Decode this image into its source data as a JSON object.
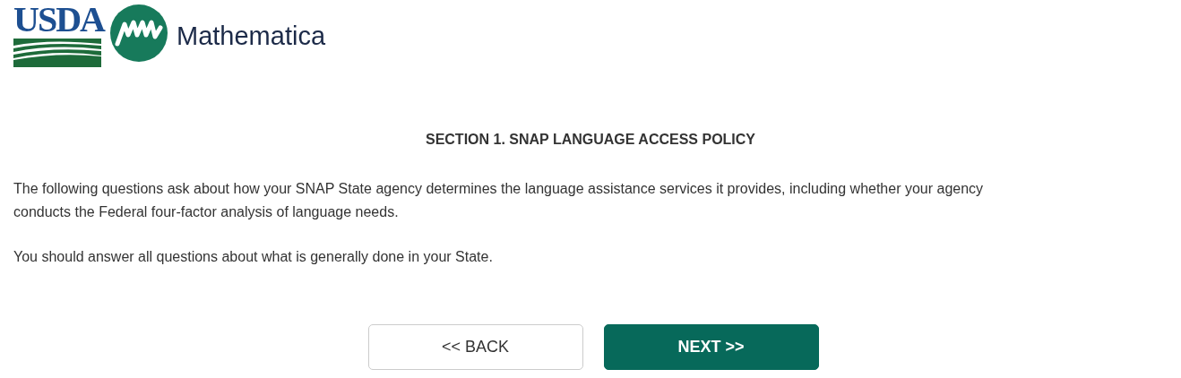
{
  "header": {
    "logos": [
      "USDA",
      "Mathematica"
    ]
  },
  "section": {
    "heading": "SECTION 1. SNAP LANGUAGE ACCESS POLICY",
    "paragraphs": [
      "The following questions ask about how your SNAP State agency determines the language assistance services it provides, including whether your agency conducts the Federal four-factor analysis of language needs.",
      "You should answer all questions about what is generally done in your State."
    ]
  },
  "buttons": [
    {
      "label": "<< BACK",
      "kind": "secondary"
    },
    {
      "label": "NEXT >>",
      "kind": "primary"
    }
  ]
}
